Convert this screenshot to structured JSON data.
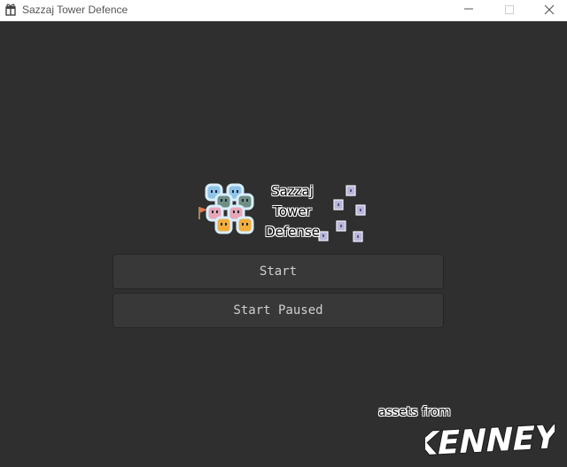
{
  "window": {
    "title": "Sazzaj Tower Defence",
    "icon": "gift-box-icon",
    "controls": [
      "minimize-icon",
      "maximize-icon",
      "close-icon"
    ]
  },
  "game": {
    "title_lines": [
      "Sazzaj",
      "Tower",
      "Defense"
    ]
  },
  "menu": {
    "start_label": "Start",
    "start_paused_label": "Start Paused"
  },
  "credits": {
    "text": "assets from",
    "brand": "KENNEY"
  },
  "colors": {
    "background": "#2f2f2f",
    "button_bg": "#383838",
    "button_text": "#cfcfcf",
    "titlebar_bg": "#ffffff"
  }
}
